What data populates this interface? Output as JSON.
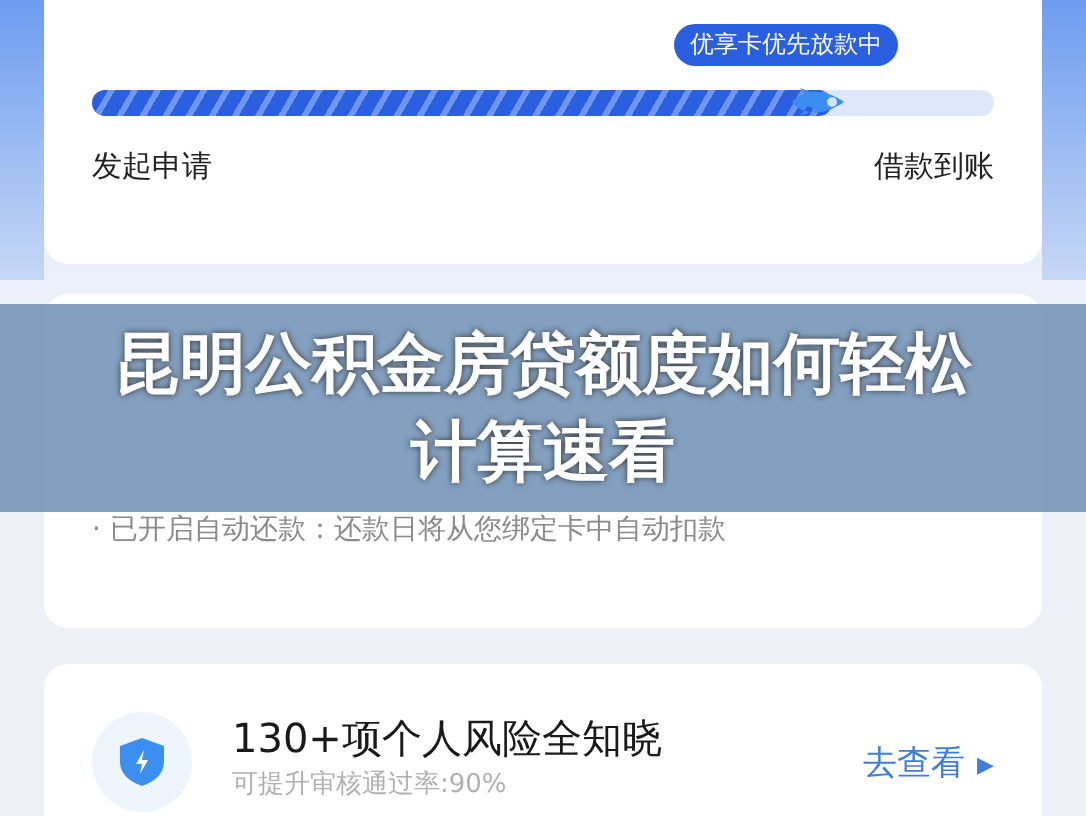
{
  "progress": {
    "badge": "优享卡优先放款中",
    "level": 0.82,
    "start_label": "发起申请",
    "end_label": "借款到账"
  },
  "reminders": [
    {
      "bullet": "·",
      "text": "已开启自动还款：还款日将从您绑定卡中自动扣款"
    }
  ],
  "risk_card": {
    "title": "130+项个人风险全知晓",
    "subtitle": "可提升审核通过率:90%",
    "link": "去查看",
    "link_arrow": "▶"
  },
  "overlay_title": "昆明公积金房贷额度如何轻松计算速看"
}
